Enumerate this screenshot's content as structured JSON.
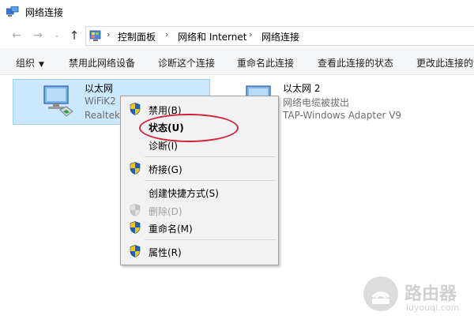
{
  "window": {
    "title": "网络连接"
  },
  "nav": {
    "back_icon": "←",
    "forward_icon": "→",
    "recent_icon": "⌄",
    "up_icon": "↑",
    "breadcrumb": [
      "控制面板",
      "网络和 Internet",
      "网络连接"
    ]
  },
  "commands": {
    "organize": "组织",
    "disable": "禁用此网络设备",
    "diagnose": "诊断这个连接",
    "rename": "重命名此连接",
    "status": "查看此连接的状态",
    "change": "更改此连接的设"
  },
  "adapters": [
    {
      "name": "以太网",
      "status": "WiFiK2",
      "device": "Realtek"
    },
    {
      "name": "以太网 2",
      "status": "网络电缆被拔出",
      "device": "TAP-Windows Adapter V9"
    }
  ],
  "context_menu": {
    "items": [
      {
        "label": "禁用(B)"
      },
      {
        "label": "状态(U)"
      },
      {
        "label": "诊断(I)"
      },
      {
        "label": "桥接(G)"
      },
      {
        "label": "创建快捷方式(S)"
      },
      {
        "label": "删除(D)"
      },
      {
        "label": "重命名(M)"
      },
      {
        "label": "属性(R)"
      }
    ]
  },
  "annotation": {
    "color": "#d4213a"
  },
  "watermark": {
    "title": "路由器",
    "subtitle": "luyouqi.com"
  },
  "colors": {
    "selection_bg": "#cce8ff",
    "selection_border": "#99d1ff",
    "menu_bg": "#f2f2f2",
    "shield_blue": "#1f5fbf",
    "shield_yellow": "#f2c511"
  }
}
